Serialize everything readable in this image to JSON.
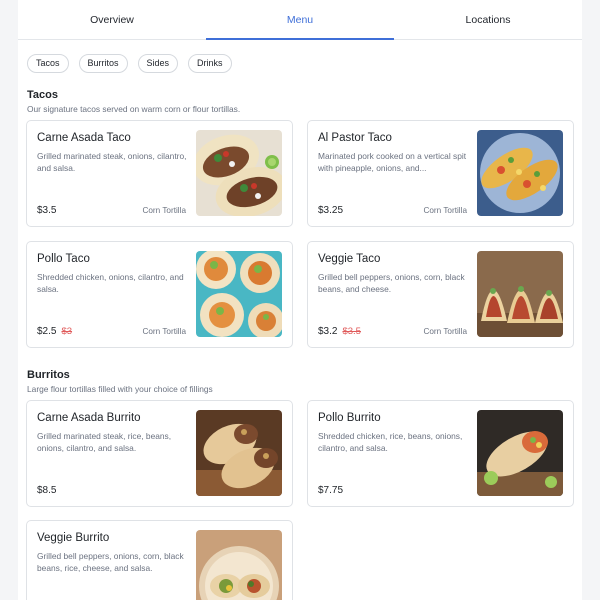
{
  "tabs": [
    {
      "label": "Overview"
    },
    {
      "label": "Menu"
    },
    {
      "label": "Locations"
    }
  ],
  "categories": [
    {
      "label": "Tacos"
    },
    {
      "label": "Burritos"
    },
    {
      "label": "Sides"
    },
    {
      "label": "Drinks"
    }
  ],
  "sections": [
    {
      "title": "Tacos",
      "description": "Our signature tacos served on warm corn or flour tortillas.",
      "items": [
        {
          "name": "Carne Asada Taco",
          "description": "Grilled marinated steak, onions, cilantro, and salsa.",
          "price": "$3.5",
          "old_price": "",
          "variant": "Corn Tortilla",
          "image_icon": "carne-asada-taco-photo"
        },
        {
          "name": "Al Pastor Taco",
          "description": "Marinated pork cooked on a vertical spit with pineapple, onions, and...",
          "price": "$3.25",
          "old_price": "",
          "variant": "Corn Tortilla",
          "image_icon": "al-pastor-taco-photo"
        },
        {
          "name": "Pollo Taco",
          "description": "Shredded chicken, onions, cilantro, and salsa.",
          "price": "$2.5",
          "old_price": "$3",
          "variant": "Corn Tortilla",
          "image_icon": "pollo-taco-photo"
        },
        {
          "name": "Veggie Taco",
          "description": "Grilled bell peppers, onions, corn, black beans, and cheese.",
          "price": "$3.2",
          "old_price": "$3.5",
          "variant": "Corn Tortilla",
          "image_icon": "veggie-taco-photo"
        }
      ]
    },
    {
      "title": "Burritos",
      "description": "Large flour tortillas filled with your choice of fillings",
      "items": [
        {
          "name": "Carne Asada Burrito",
          "description": "Grilled marinated steak, rice, beans, onions, cilantro, and salsa.",
          "price": "$8.5",
          "old_price": "",
          "variant": "",
          "image_icon": "carne-asada-burrito-photo"
        },
        {
          "name": "Pollo Burrito",
          "description": "Shredded chicken, rice, beans, onions, cilantro, and salsa.",
          "price": "$7.75",
          "old_price": "",
          "variant": "",
          "image_icon": "pollo-burrito-photo"
        },
        {
          "name": "Veggie Burrito",
          "description": "Grilled bell peppers, onions, corn, black beans, rice, cheese, and salsa.",
          "price": "",
          "old_price": "",
          "variant": "",
          "image_icon": "veggie-burrito-photo"
        }
      ]
    }
  ],
  "colors": {
    "accent": "#3f6fd8",
    "sale": "#e05a5a",
    "muted": "#6b7280"
  }
}
